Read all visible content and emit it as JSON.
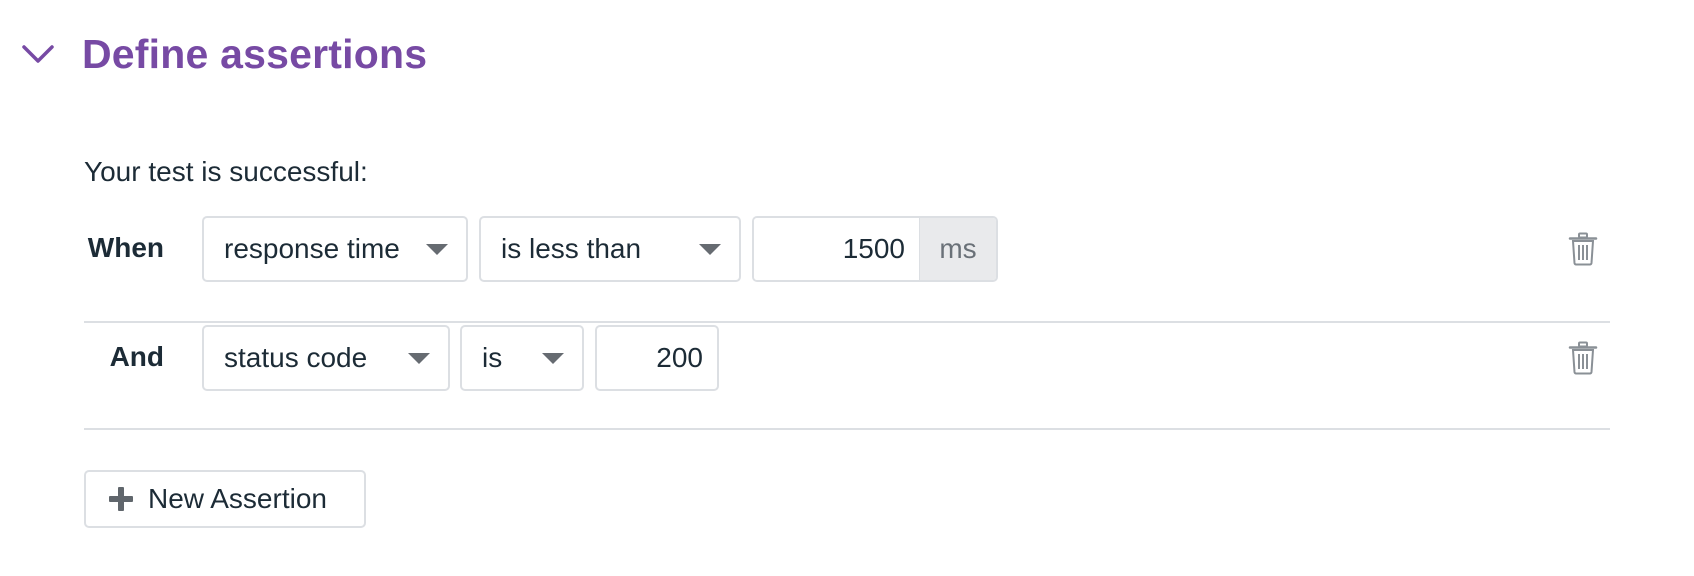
{
  "section": {
    "title": "Define assertions",
    "collapse_icon": "chevron-down-icon"
  },
  "intro": "Your test is successful:",
  "assertions": [
    {
      "connector": "When",
      "target": "response time",
      "operator": "is less than",
      "value": "1500",
      "unit": "ms",
      "delete_icon": "trash-icon"
    },
    {
      "connector": "And",
      "target": "status code",
      "operator": "is",
      "value": "200",
      "delete_icon": "trash-icon"
    }
  ],
  "new_assertion": {
    "label": "New Assertion",
    "icon": "plus-icon"
  },
  "colors": {
    "accent": "#774aa4",
    "text": "#1c2b36",
    "border": "#dcdfe3",
    "unit_bg": "#e9eaec",
    "icon": "#666b71"
  }
}
